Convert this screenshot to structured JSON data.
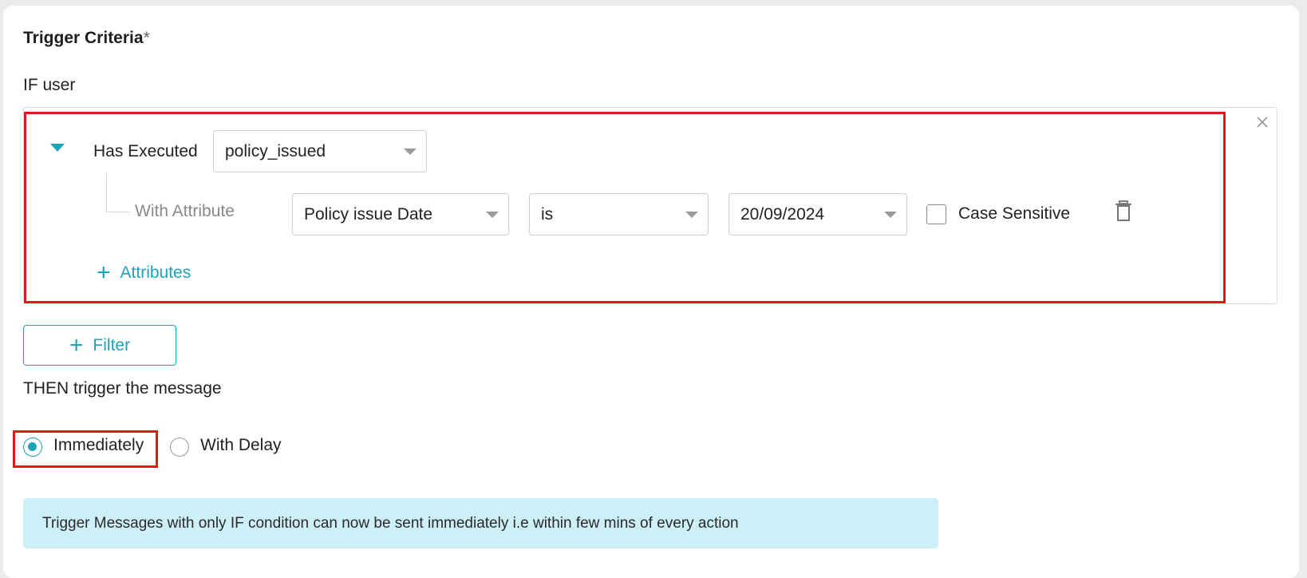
{
  "section": {
    "title": "Trigger Criteria",
    "required_marker": "*",
    "if_label": "IF user"
  },
  "condition": {
    "verb_label": "Has Executed",
    "event_value": "policy_issued",
    "attribute": {
      "prefix_label": "With Attribute",
      "attribute_value": "Policy issue Date",
      "operator_value": "is",
      "date_value": "20/09/2024",
      "case_sensitive_label": "Case Sensitive",
      "case_sensitive_checked": false
    },
    "add_attributes_label": "Attributes"
  },
  "filter_button_label": "Filter",
  "then_label": "THEN trigger the message",
  "timing": {
    "options": [
      {
        "label": "Immediately",
        "selected": true
      },
      {
        "label": "With Delay",
        "selected": false
      }
    ]
  },
  "info_message": "Trigger Messages with only IF condition can now be sent immediately i.e within few mins of every action",
  "colors": {
    "accent": "#1fa3b7",
    "highlight": "#e31818",
    "info_background": "#cdeff8"
  },
  "icons": [
    "close-icon",
    "caret-down-icon",
    "chevron-down-icon",
    "trash-icon",
    "plus-icon"
  ]
}
